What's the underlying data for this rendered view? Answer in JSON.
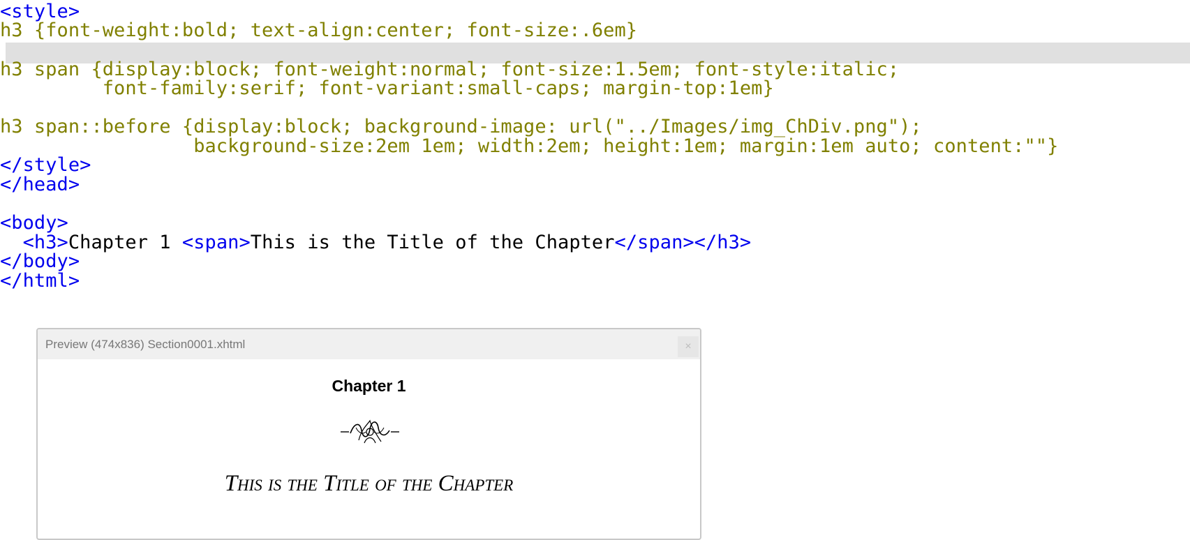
{
  "code": {
    "line1": "<style>",
    "line2": "h3 {font-weight:bold; text-align:center; font-size:.6em}",
    "line4": "h3 span {display:block; font-weight:normal; font-size:1.5em; font-style:italic;",
    "line5": "         font-family:serif; font-variant:small-caps; margin-top:1em}",
    "line7": "h3 span::before {display:block; background-image: url(\"../Images/img_ChDiv.png\");",
    "line8": "                 background-size:2em 1em; width:2em; height:1em; margin:1em auto; content:\"\"}",
    "line9": "</style>",
    "line10": "</head>",
    "line12": "<body>",
    "line13_indent": "  ",
    "line13_open_h3": "<h3>",
    "line13_text1": "Chapter 1 ",
    "line13_open_span": "<span>",
    "line13_text2": "This is the Title of the Chapter",
    "line13_close": "</span></h3>",
    "line14": "</body>",
    "line15": "</html>"
  },
  "preview": {
    "title": "Preview (474x836) Section0001.xhtml",
    "close_label": "×",
    "chapter_heading": "Chapter 1",
    "chapter_title": "This is the Title of the Chapter"
  }
}
